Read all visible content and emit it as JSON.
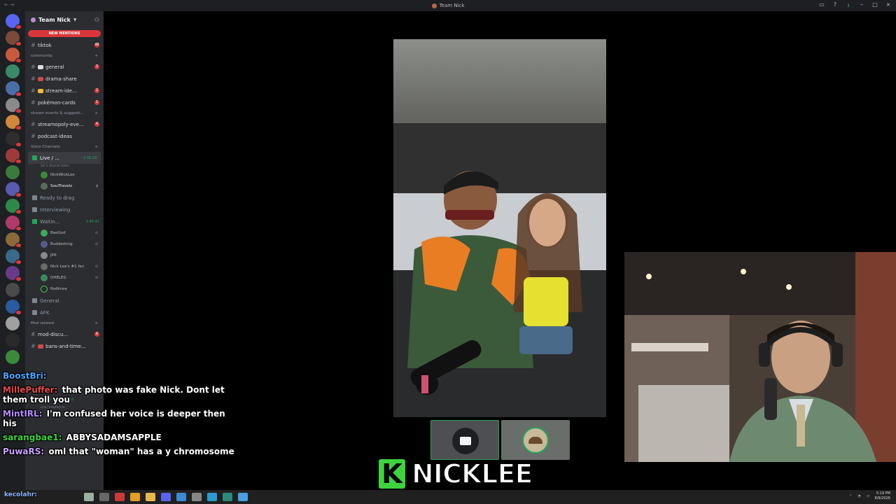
{
  "window": {
    "title": "Team Nick"
  },
  "server": {
    "name": "Team Nick",
    "mentions_label": "NEW MENTIONS"
  },
  "channels": {
    "tiktok": {
      "label": "tiktok",
      "badge": "46"
    },
    "category_community": "community",
    "general": {
      "label": "general",
      "badge": "3"
    },
    "drama": {
      "label": "drama-share"
    },
    "stream_ideas": {
      "label": "stream-ide...",
      "badge": "2"
    },
    "pokemon": {
      "label": "pokémon-cards",
      "badge": "1"
    },
    "category_stream": "stream events & suggesti...",
    "streamopoly": {
      "label": "streamopoly-eve...",
      "badge": "4"
    },
    "podcast": {
      "label": "podcast-ideas"
    },
    "category_voice": "Voice Channels",
    "live": {
      "label": "Live / ...",
      "timer": "2:38:29",
      "status": "Set a channel status"
    },
    "live_users": [
      "NickWickLee",
      "SoulTravels"
    ],
    "ready": "Ready to drag",
    "interviewing": "Interviewing",
    "waiting": {
      "label": "Waitin...",
      "timer": "2:45:41"
    },
    "waiting_users": [
      "BaeGod",
      "Budderking",
      "JPR",
      "Nick Lee's #1 fan",
      "OHELEG",
      "Rodknee"
    ],
    "general_voice": "General",
    "afk": "AFK",
    "category_mod": "Mod related",
    "mod_discu": {
      "label": "mod-discu...",
      "badge": "6"
    },
    "bans": {
      "label": "bans-and-time..."
    }
  },
  "chat": [
    {
      "user": "BoostBri:",
      "text": "",
      "color": "#4aa3ff"
    },
    {
      "user": "MillePuffer:",
      "text": "that photo was fake Nick. Dont let them troll you",
      "color": "#e04a4a"
    },
    {
      "user": "MintIRL:",
      "text": "I'm confused her voice is deeper then his",
      "color": "#b58cff"
    },
    {
      "user": "sarangbae1:",
      "text": "ABBYSADAMSAPPLE",
      "color": "#3ed33e"
    },
    {
      "user": "PuwaRS:",
      "text": "oml that \"woman\" has a y chromosome",
      "color": "#c8a0ff"
    }
  ],
  "voice_footer": {
    "status": "Video Connected",
    "sub": "Live / meeting ro..."
  },
  "logo": {
    "word": "NICKLEE",
    "letter": "K"
  },
  "taskbar": {
    "user": "kecolahr:",
    "time": "5:19 PM",
    "date": "8/9/2026"
  }
}
